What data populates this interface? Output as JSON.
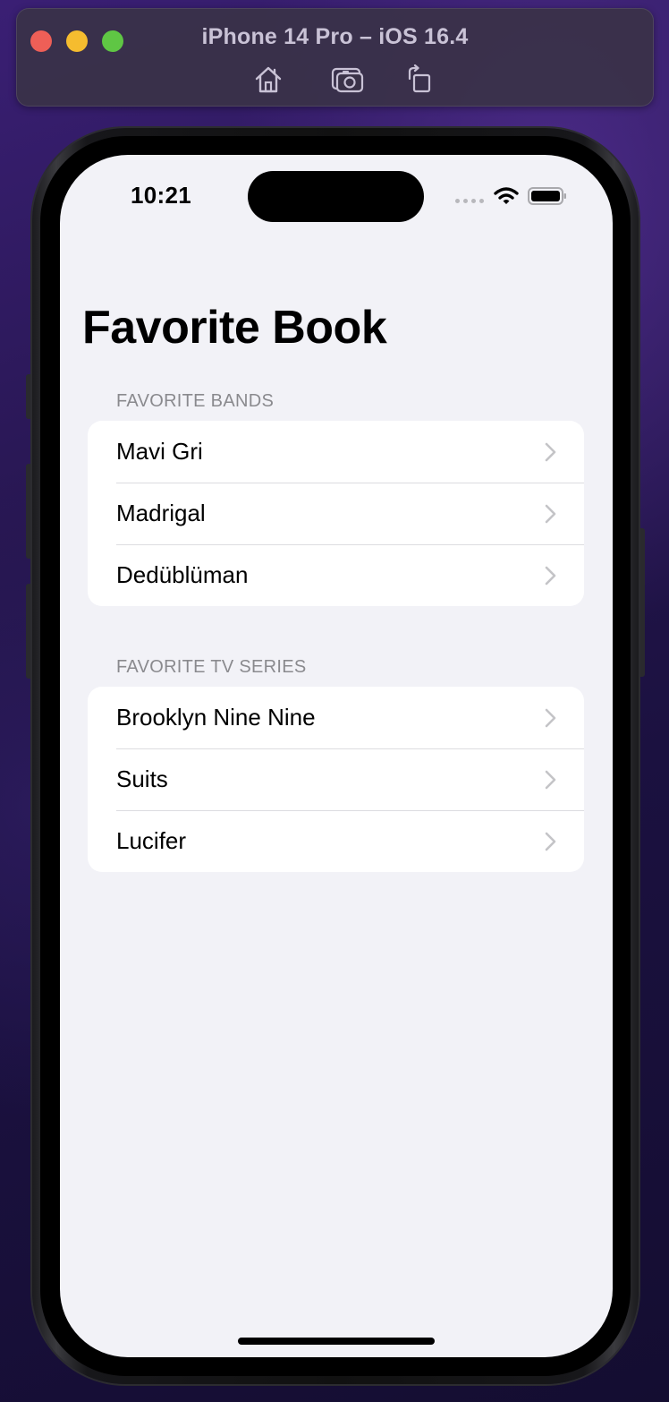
{
  "simulator": {
    "title": "iPhone 14 Pro – iOS 16.4",
    "toolbar": [
      "home-icon",
      "screenshot-icon",
      "rotate-icon"
    ]
  },
  "status_bar": {
    "time": "10:21"
  },
  "page": {
    "title": "Favorite Book"
  },
  "sections": [
    {
      "header": "FAVORITE BANDS",
      "rows": [
        {
          "label": "Mavi Gri"
        },
        {
          "label": "Madrigal"
        },
        {
          "label": "Dedüblüman"
        }
      ]
    },
    {
      "header": "FAVORITE TV SERIES",
      "rows": [
        {
          "label": "Brooklyn Nine Nine"
        },
        {
          "label": "Suits"
        },
        {
          "label": "Lucifer"
        }
      ]
    }
  ],
  "colors": {
    "background": "#f2f2f7",
    "cell": "#ffffff",
    "section_header": "#8a8a8e",
    "chevron": "#c4c4c7",
    "close": "#ee5f57",
    "minimize": "#f5bc2f",
    "zoom": "#5fc644"
  }
}
